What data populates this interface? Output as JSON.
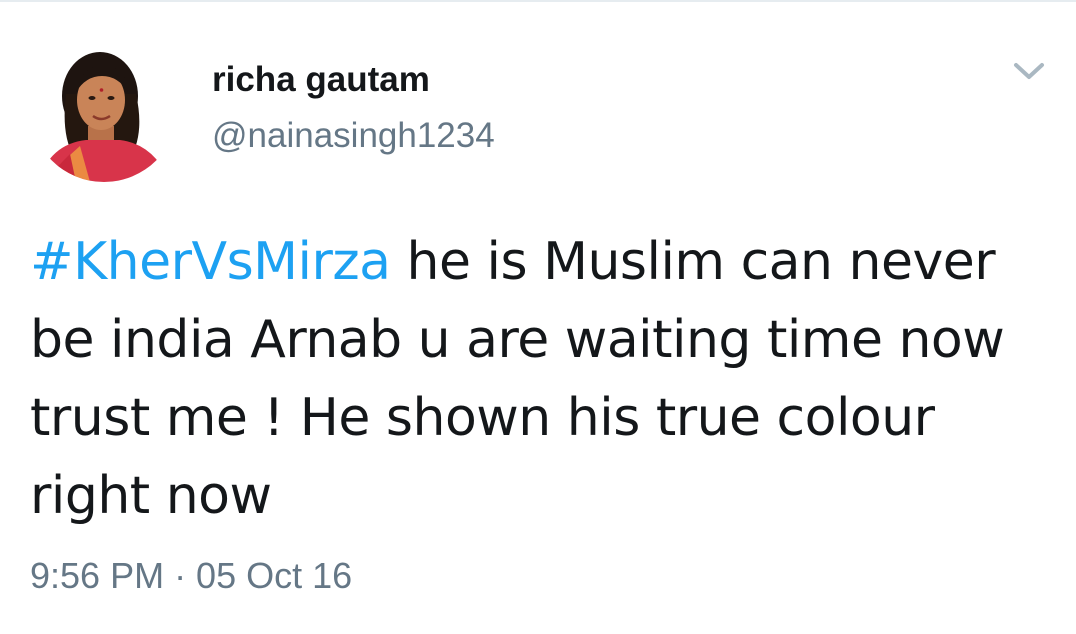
{
  "author": {
    "display_name": "richa gautam",
    "handle": "@nainasingh1234",
    "avatar_icon": "user-avatar-photo"
  },
  "menu_icon": "chevron-down-icon",
  "tweet": {
    "hashtag": "#KherVsMirza",
    "text": " he is Muslim can never be india Arnab u are waiting time now trust me ! He shown his true colour right now"
  },
  "timestamp": "9:56 PM · 05 Oct 16",
  "colors": {
    "link": "#1da1f2",
    "text": "#14171a",
    "secondary": "#657786"
  }
}
